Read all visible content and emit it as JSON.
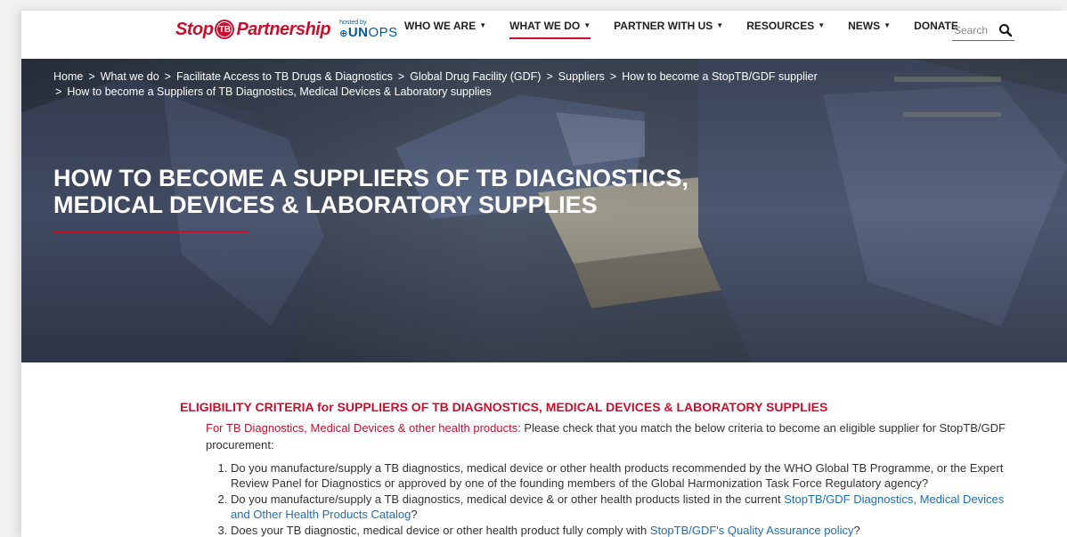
{
  "logo": {
    "stop": "Stop",
    "tb": "TB",
    "partnership": "Partnership",
    "hosted_by": "hosted by",
    "unops_un": "UN",
    "unops_ops": "OPS"
  },
  "nav": {
    "items": [
      {
        "label": "WHO WE ARE",
        "dropdown": true
      },
      {
        "label": "WHAT WE DO",
        "dropdown": true,
        "active": true
      },
      {
        "label": "PARTNER WITH US",
        "dropdown": true
      },
      {
        "label": "RESOURCES",
        "dropdown": true
      },
      {
        "label": "NEWS",
        "dropdown": true
      },
      {
        "label": "DONATE",
        "dropdown": false
      }
    ],
    "search_placeholder": "Search"
  },
  "breadcrumb": [
    "Home",
    "What we do",
    "Facilitate Access to TB Drugs & Diagnostics",
    "Global Drug Facility (GDF)",
    "Suppliers",
    "How to become a StopTB/GDF supplier",
    "How to become a Suppliers of TB Diagnostics, Medical Devices & Laboratory supplies"
  ],
  "hero": {
    "title": "HOW TO BECOME A SUPPLIERS OF TB DIAGNOSTICS, MEDICAL DEVICES & LABORATORY SUPPLIES"
  },
  "content": {
    "heading": "ELIGIBILITY CRITERIA for SUPPLIERS OF TB DIAGNOSTICS, MEDICAL DEVICES & LABORATORY SUPPLIES",
    "intro_prefix": "For TB Diagnostics, Medical Devices & other health products",
    "intro_text": ": Please check that you match the below criteria to become an eligible supplier for StopTB/GDF procurement:",
    "criteria": [
      {
        "text": "Do you manufacture/supply a TB diagnostics, medical device or other health products recommended by the WHO Global TB Programme, or the Expert Review Panel for Diagnostics or approved by one of the founding members of the Global Harmonization Task Force Regulatory agency?"
      },
      {
        "before": "Do you manufacture/supply a TB diagnostics, medical device & or other health products listed in the current ",
        "link": "StopTB/GDF Diagnostics, Medical Devices and Other Health Products Catalog",
        "after": "?"
      },
      {
        "before": "Does your TB diagnostic, medical device or other health product fully comply with ",
        "link": "StopTB/GDF's Quality Assurance policy",
        "after": "?"
      }
    ]
  },
  "colors": {
    "brand_red": "#c8102e",
    "unops_blue": "#005a9c",
    "link_blue": "#1f6eb5"
  }
}
